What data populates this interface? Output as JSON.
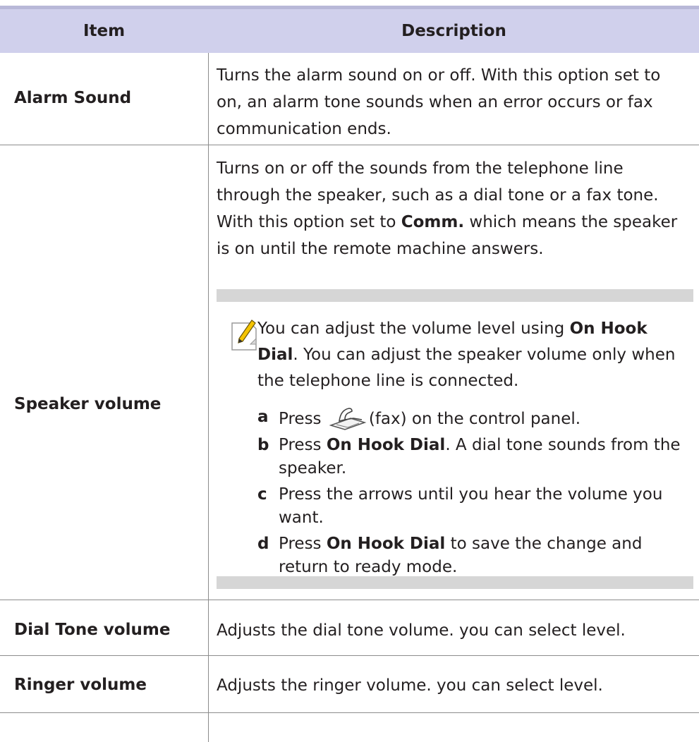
{
  "header": {
    "item": "Item",
    "description": "Description"
  },
  "rows": [
    {
      "item": "Alarm Sound",
      "description": "Turns the alarm sound on or off. With this option set to on, an alarm tone sounds when an error occurs or fax communication ends."
    },
    {
      "item": "Speaker volume",
      "desc_part1": "Turns on or off the sounds from the telephone line through the speaker, such as a dial tone or a fax tone. With this option set to ",
      "desc_bold": "Comm.",
      "desc_part2": " which means the speaker is on until the remote machine answers.",
      "note": {
        "intro_pre": "You can adjust the volume level using ",
        "intro_bold": "On Hook Dial",
        "intro_post": ". You can adjust the speaker volume only when the telephone line is connected.",
        "steps": [
          {
            "letter": "a",
            "pre": "Press ",
            "icon_caption": "(fax) on the control panel."
          },
          {
            "letter": "b",
            "pre": "Press ",
            "bold": "On Hook Dial",
            "post": ". A dial tone sounds from the speaker."
          },
          {
            "letter": "c",
            "text": "Press the arrows until you hear the volume you want."
          },
          {
            "letter": "d",
            "pre": "Press ",
            "bold": "On Hook Dial",
            "post": " to save the change and return to ready mode."
          }
        ]
      }
    },
    {
      "item": "Dial Tone volume",
      "description": "Adjusts the dial tone volume. you can select level."
    },
    {
      "item": "Ringer volume",
      "description": "Adjusts the ringer volume. you can select level."
    }
  ],
  "icons": {
    "note": "note-pencil-icon",
    "fax": "fax-phone-icon"
  },
  "colors": {
    "header_bg": "#d0d0ec",
    "rule": "#b8b8d8",
    "note_band": "#d6d6d6",
    "pencil": "#f5c400"
  }
}
